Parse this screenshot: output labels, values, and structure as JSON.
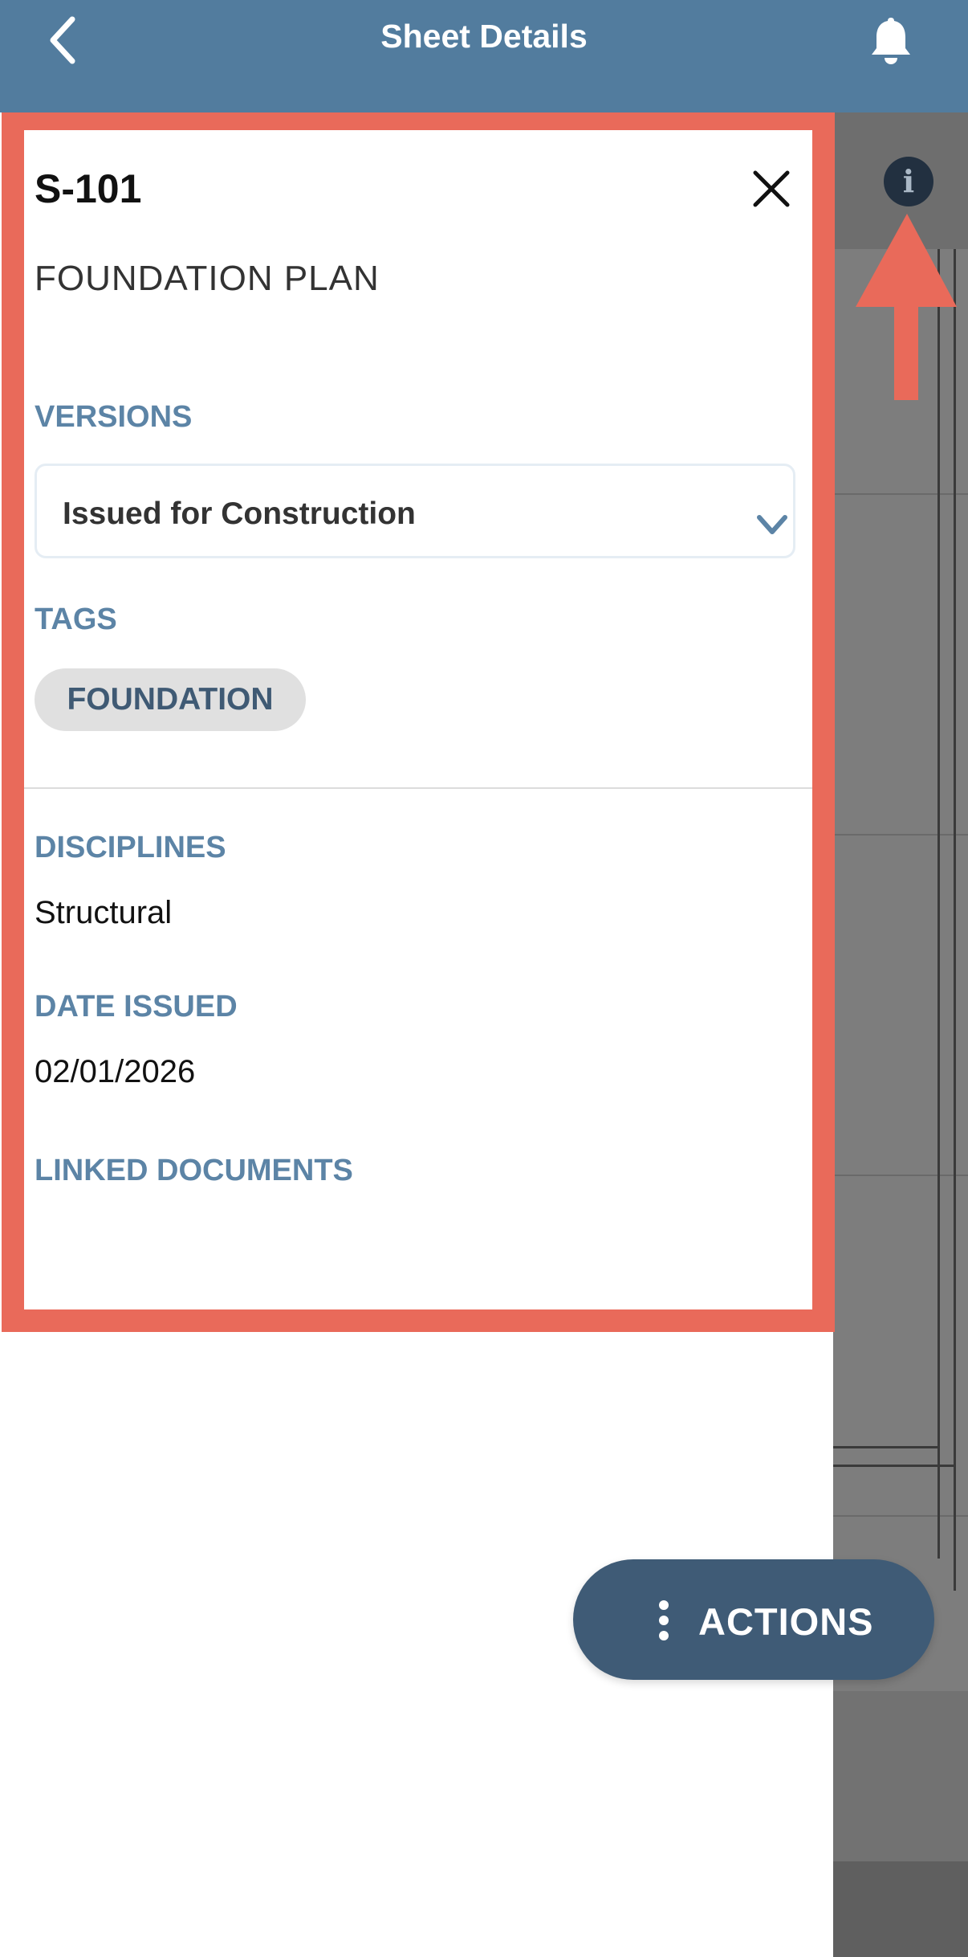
{
  "header": {
    "title": "Sheet Details",
    "back_icon": "chevron-left-icon",
    "notification_icon": "bell-icon"
  },
  "viewer": {
    "info_icon_glyph": "i"
  },
  "panel": {
    "sheet_number": "S-101",
    "sheet_name": "FOUNDATION PLAN",
    "versions_label": "VERSIONS",
    "version_selected": "Issued for Construction",
    "tags_label": "TAGS",
    "tags": [
      "FOUNDATION"
    ],
    "disciplines_label": "DISCIPLINES",
    "discipline": "Structural",
    "date_label": "DATE ISSUED",
    "date_value": "02/01/2026",
    "linked_label": "LINKED DOCUMENTS"
  },
  "actions": {
    "label": "ACTIONS"
  },
  "colors": {
    "header_bg": "#527c9e",
    "highlight": "#e96a5a",
    "label_blue": "#5c84a6",
    "actions_bg": "#3f5b76"
  }
}
